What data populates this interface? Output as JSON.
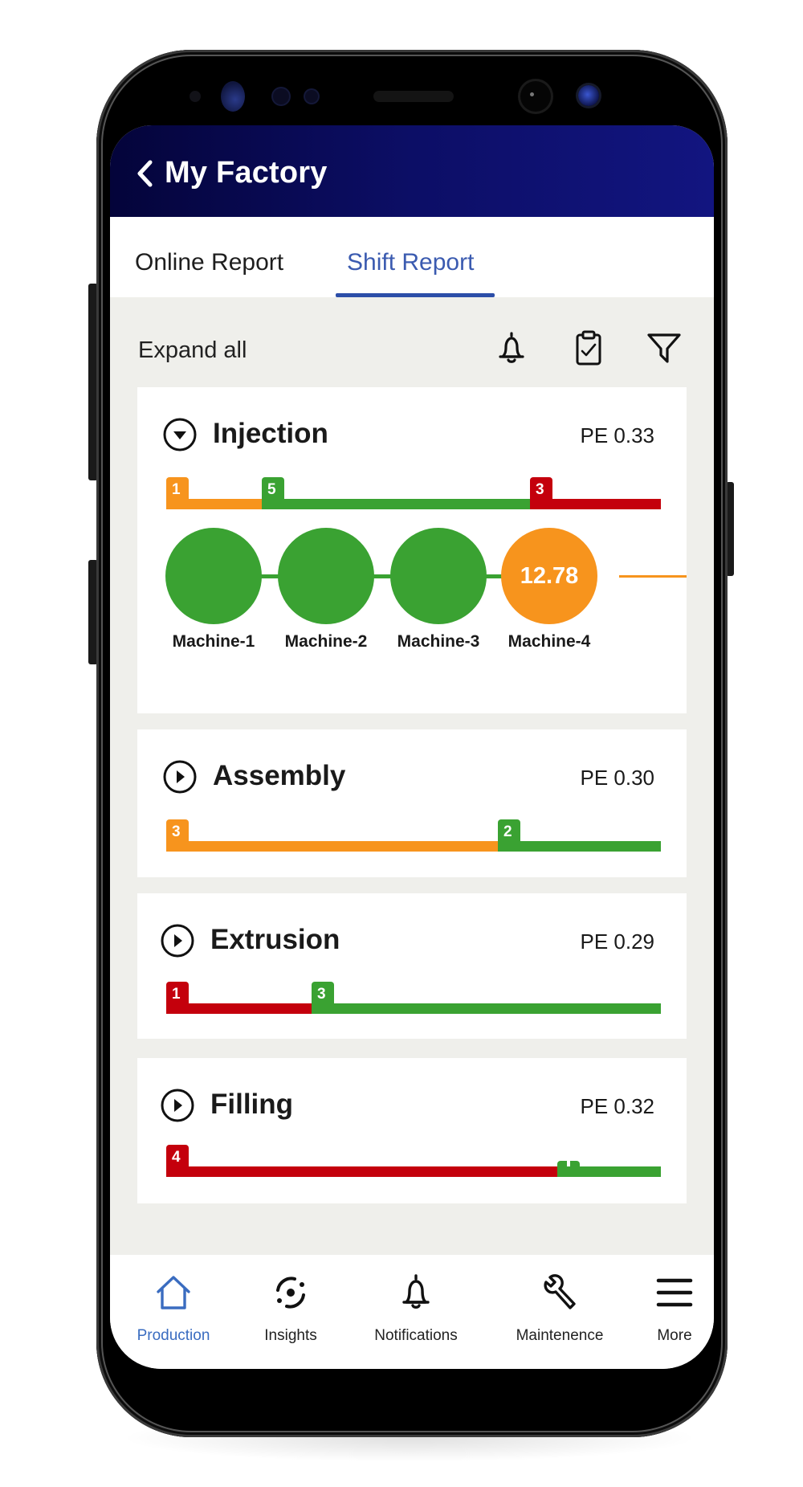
{
  "app": {
    "title": "My Factory",
    "back_icon": "chevron-left-icon"
  },
  "tabs": [
    {
      "label": "Online Report",
      "active": false
    },
    {
      "label": "Shift Report",
      "active": true
    }
  ],
  "toolbar": {
    "expand_all_label": "Expand all",
    "icons": [
      "bell-icon",
      "clipboard-check-icon",
      "filter-icon"
    ]
  },
  "colors": {
    "green": "#3aa232",
    "orange": "#f7941d",
    "red": "#c4000c",
    "header_start": "#04043a",
    "header_end": "#121580",
    "tab_active": "#3b5bb0",
    "nav_active": "#3a6cc0"
  },
  "sections": [
    {
      "name": "Injection",
      "pe": "PE 0.33",
      "expanded": true,
      "segments": [
        {
          "status": "orange",
          "count": "1",
          "fraction": 0.193
        },
        {
          "status": "green",
          "count": "5",
          "fraction": 0.543
        },
        {
          "status": "red",
          "count": "3",
          "fraction": 0.264
        }
      ],
      "machines": [
        {
          "name": "Machine-1",
          "status": "green",
          "value": ""
        },
        {
          "name": "Machine-2",
          "status": "green",
          "value": ""
        },
        {
          "name": "Machine-3",
          "status": "green",
          "value": ""
        },
        {
          "name": "Machine-4",
          "status": "orange",
          "value": "12.78"
        }
      ]
    },
    {
      "name": "Assembly",
      "pe": "PE 0.30",
      "expanded": false,
      "segments": [
        {
          "status": "orange",
          "count": "3",
          "fraction": 0.67
        },
        {
          "status": "green",
          "count": "2",
          "fraction": 0.33
        }
      ]
    },
    {
      "name": "Extrusion",
      "pe": "PE 0.29",
      "expanded": false,
      "segments": [
        {
          "status": "red",
          "count": "1",
          "fraction": 0.294
        },
        {
          "status": "green",
          "count": "3",
          "fraction": 0.706
        }
      ]
    },
    {
      "name": "Filling",
      "pe": "PE 0.32",
      "expanded": false,
      "segments": [
        {
          "status": "red",
          "count": "4",
          "fraction": 0.79
        },
        {
          "status": "green",
          "count": "",
          "fraction": 0.21,
          "truncated": true
        }
      ]
    }
  ],
  "bottom_nav": [
    {
      "label": "Production",
      "icon": "home-icon",
      "active": true
    },
    {
      "label": "Insights",
      "icon": "insights-icon",
      "active": false
    },
    {
      "label": "Notifications",
      "icon": "bell-icon",
      "active": false
    },
    {
      "label": "Maintenence",
      "icon": "wrench-icon",
      "active": false
    },
    {
      "label": "More",
      "icon": "menu-icon",
      "active": false
    }
  ]
}
